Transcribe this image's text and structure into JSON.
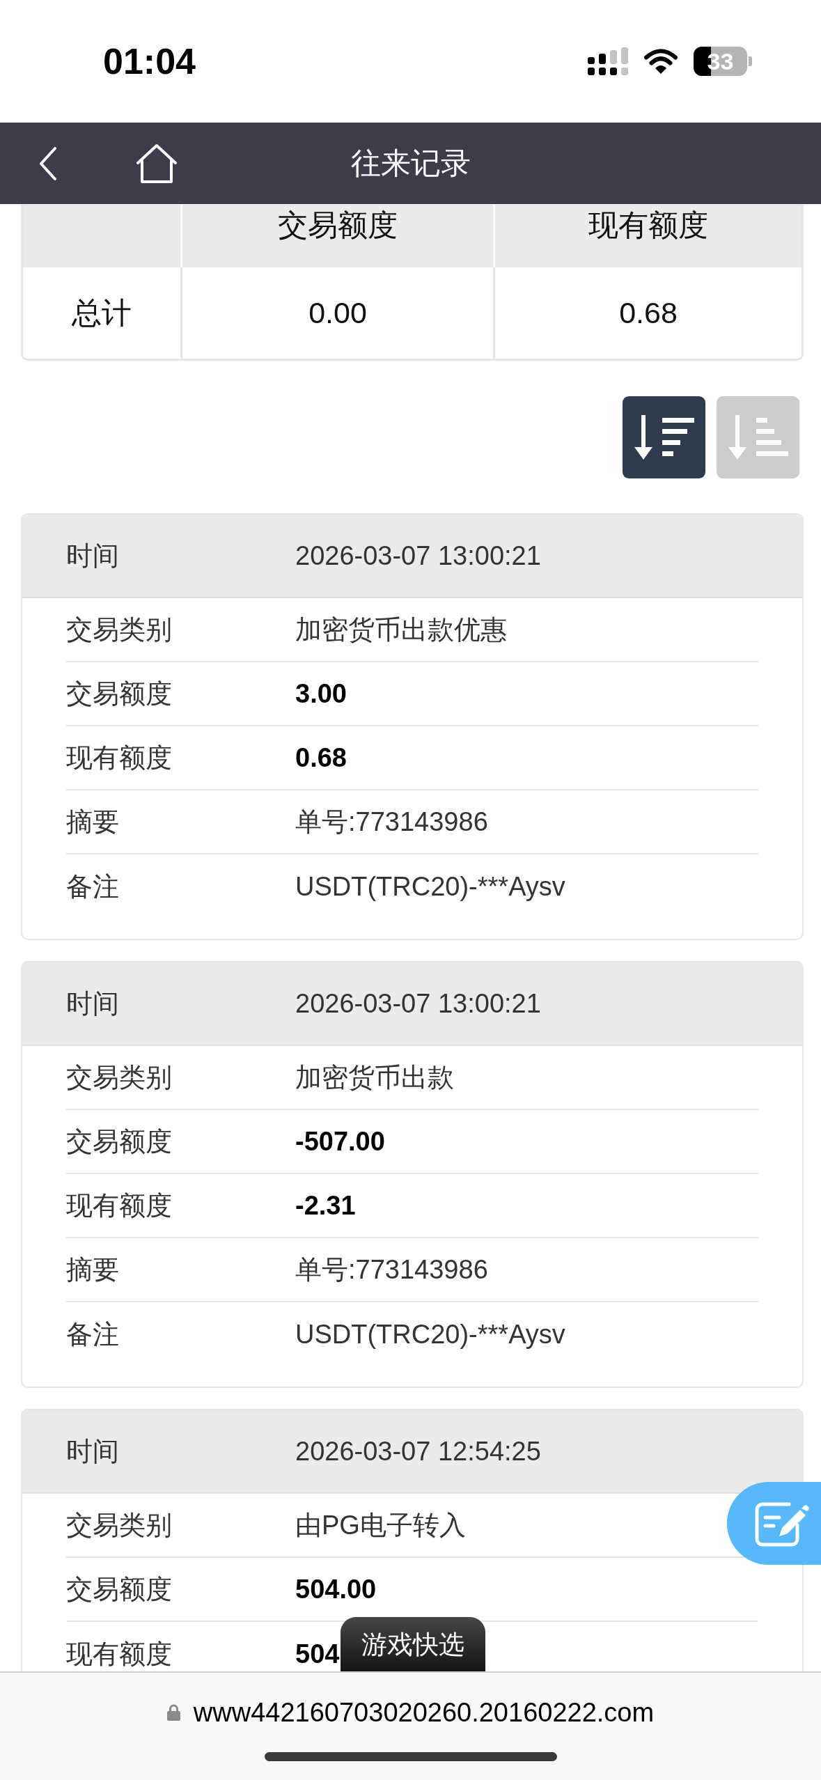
{
  "status_bar": {
    "time": "01:04",
    "battery": "33"
  },
  "nav_bar": {
    "title": "往来记录"
  },
  "summary_table": {
    "columns": [
      "交易额度",
      "现有额度"
    ],
    "rows": [
      {
        "label": "总计",
        "cells": [
          "0.00",
          "0.68"
        ]
      }
    ]
  },
  "sort_buttons": [
    {
      "kind": "descending",
      "selected": true
    },
    {
      "kind": "ascending",
      "selected": false
    }
  ],
  "records": [
    {
      "time_label": "时间",
      "time": "2026-03-07 13:00:21",
      "fields": [
        {
          "label": "交易类别",
          "value": "加密货币出款优惠",
          "bold": false
        },
        {
          "label": "交易额度",
          "value": "3.00",
          "bold": true
        },
        {
          "label": "现有额度",
          "value": "0.68",
          "bold": true
        },
        {
          "label": "摘要",
          "value": "单号:773143986",
          "bold": false
        },
        {
          "label": "备注",
          "value": "USDT(TRC20)-***Aysv",
          "bold": false
        }
      ]
    },
    {
      "time_label": "时间",
      "time": "2026-03-07 13:00:21",
      "fields": [
        {
          "label": "交易类别",
          "value": "加密货币出款",
          "bold": false
        },
        {
          "label": "交易额度",
          "value": "-507.00",
          "bold": true
        },
        {
          "label": "现有额度",
          "value": "-2.31",
          "bold": true
        },
        {
          "label": "摘要",
          "value": "单号:773143986",
          "bold": false
        },
        {
          "label": "备注",
          "value": "USDT(TRC20)-***Aysv",
          "bold": false
        }
      ]
    },
    {
      "time_label": "时间",
      "time": "2026-03-07 12:54:25",
      "fields": [
        {
          "label": "交易类别",
          "value": "由PG电子转入",
          "bold": false
        },
        {
          "label": "交易额度",
          "value": "504.00",
          "bold": true
        },
        {
          "label": "现有额度",
          "value": "504",
          "bold": true
        }
      ]
    }
  ],
  "bottom_tab": {
    "label": "游戏快选"
  },
  "address_bar": {
    "url": "www442160703020260.20160222.com"
  }
}
